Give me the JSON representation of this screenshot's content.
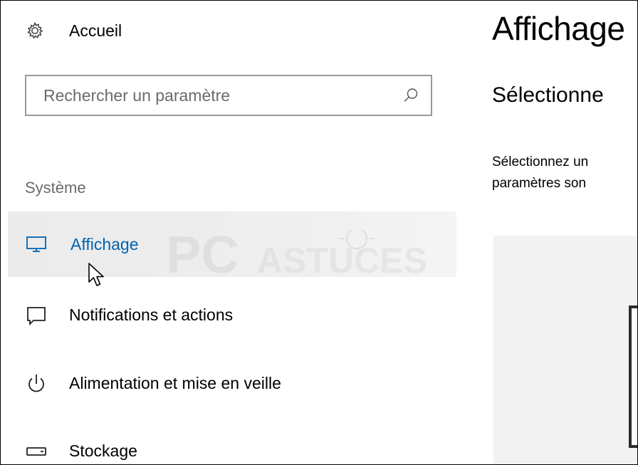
{
  "nav": {
    "home_label": "Accueil",
    "home_icon": "gear-icon",
    "search_placeholder": "Rechercher un paramètre",
    "section_title": "Système",
    "items": [
      {
        "label": "Affichage",
        "icon": "monitor-icon",
        "selected": true
      },
      {
        "label": "Notifications et actions",
        "icon": "notification-icon",
        "selected": false
      },
      {
        "label": "Alimentation et mise en veille",
        "icon": "power-icon",
        "selected": false
      },
      {
        "label": "Stockage",
        "icon": "storage-icon",
        "selected": false
      }
    ]
  },
  "content": {
    "title": "Affichage",
    "subheading": "Sélectionne",
    "description_lines": [
      "Sélectionnez un",
      "paramètres son"
    ]
  },
  "watermark": {
    "text_bold": "PC",
    "text_light": "ASTUCES"
  },
  "colors": {
    "accent": "#0063b1",
    "selected_bg": "#eeeeee",
    "section_text": "#6b6b6b",
    "search_border": "#999999"
  }
}
